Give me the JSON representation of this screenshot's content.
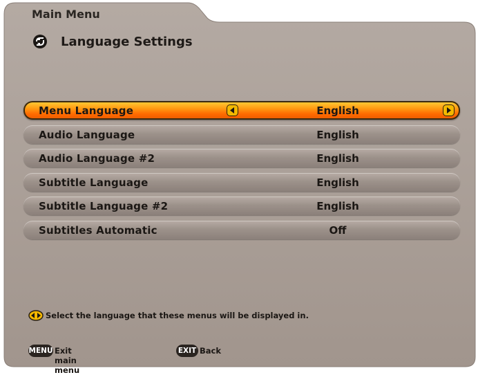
{
  "header": {
    "breadcrumb": "Main Menu",
    "title": "Language Settings",
    "title_icon": "back-arrow-icon"
  },
  "menu": {
    "items": [
      {
        "label": "Menu Language",
        "value": "English",
        "selected": true
      },
      {
        "label": "Audio Language",
        "value": "English",
        "selected": false
      },
      {
        "label": "Audio Language #2",
        "value": "English",
        "selected": false
      },
      {
        "label": "Subtitle Language",
        "value": "English",
        "selected": false
      },
      {
        "label": "Subtitle Language #2",
        "value": "English",
        "selected": false
      },
      {
        "label": "Subtitles Automatic",
        "value": "Off",
        "selected": false
      }
    ]
  },
  "help": {
    "icon": "left-right-icon",
    "text": "Select the language that these menus will be displayed in."
  },
  "footer": {
    "menu_key": "MENU",
    "menu_label": "Exit main menu",
    "exit_key": "EXIT",
    "exit_label": "Back"
  },
  "colors": {
    "panel": "#a69a92",
    "highlight": "#ff8c0a",
    "row": "#9d928b",
    "text": "#1b1714"
  }
}
